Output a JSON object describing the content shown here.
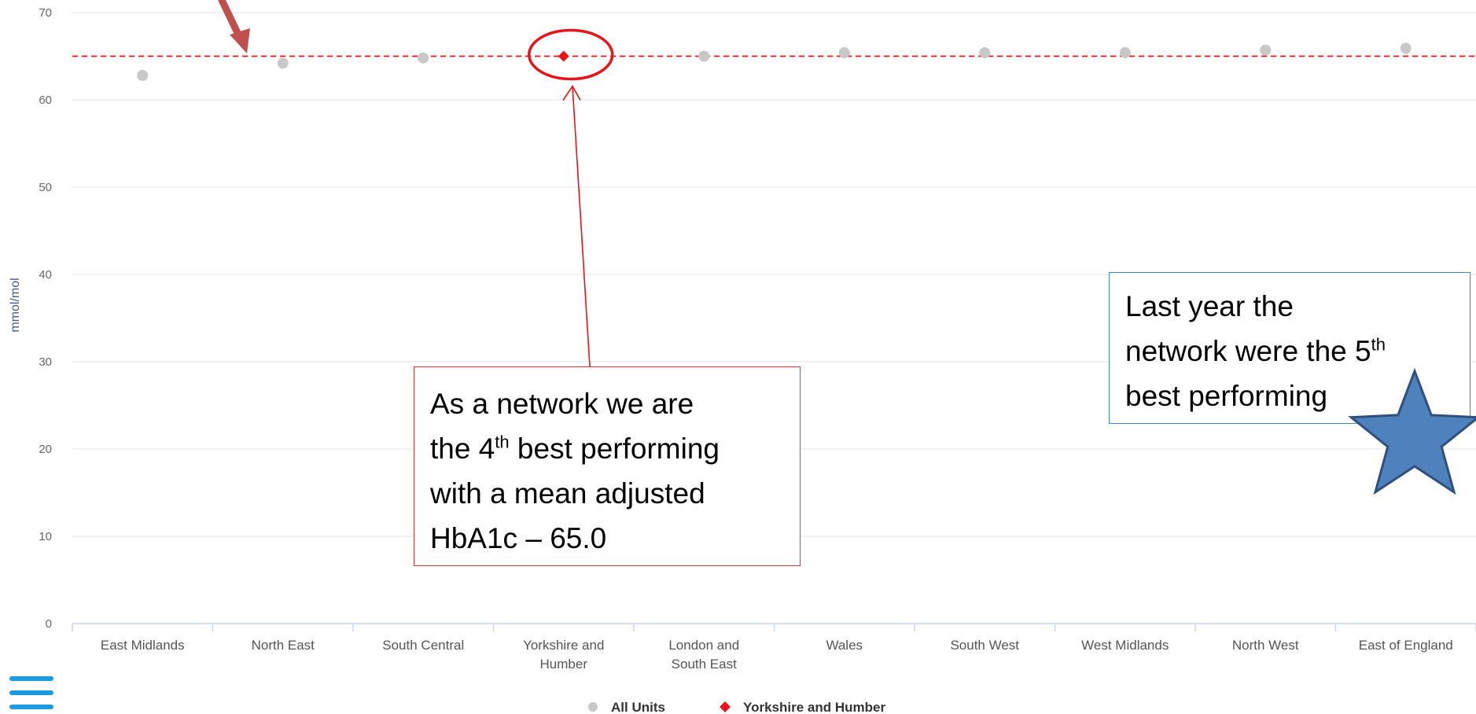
{
  "chart_data": {
    "type": "scatter",
    "ylabel": "mmol/mol",
    "ylim": [
      0,
      70
    ],
    "yticks": [
      0,
      10,
      20,
      30,
      40,
      50,
      60,
      70
    ],
    "categories": [
      [
        "East Midlands"
      ],
      [
        "North East"
      ],
      [
        "South Central"
      ],
      [
        "Yorkshire and",
        "Humber"
      ],
      [
        "London and",
        "South East"
      ],
      [
        "Wales"
      ],
      [
        "South West"
      ],
      [
        "West Midlands"
      ],
      [
        "North West"
      ],
      [
        "East of England"
      ]
    ],
    "series": [
      {
        "name": "All Units",
        "color": "#c8c8c8",
        "marker": "circle",
        "values": [
          62.8,
          64.2,
          64.8,
          null,
          65.0,
          65.4,
          65.4,
          65.4,
          65.7,
          65.9
        ]
      },
      {
        "name": "Yorkshire and Humber",
        "color": "#e8141c",
        "marker": "diamond",
        "values": [
          null,
          null,
          null,
          65.0,
          null,
          null,
          null,
          null,
          null,
          null
        ]
      }
    ],
    "reference_line": {
      "value": 65.0,
      "color": "#e8141c",
      "style": "dashed"
    },
    "highlight_index": 3,
    "legend_position": "bottom-center",
    "grid": true
  },
  "annotations": {
    "current": {
      "lines": [
        [
          "As a network we are"
        ],
        [
          "the 4",
          "th",
          " best performing"
        ],
        [
          "with a mean adjusted"
        ],
        [
          "HbA1c –  65.0"
        ]
      ],
      "border_color": "#e8343a"
    },
    "last_year": {
      "lines": [
        [
          "Last year the"
        ],
        [
          "network were the 5",
          "th"
        ],
        [
          "best performing"
        ]
      ],
      "border_color": "#3f86c6"
    },
    "star_color": "#4f81bd",
    "arrow_color": "#c0504d"
  },
  "ui": {
    "menu_icon": "hamburger-icon",
    "menu_color": "#1e9be0"
  }
}
